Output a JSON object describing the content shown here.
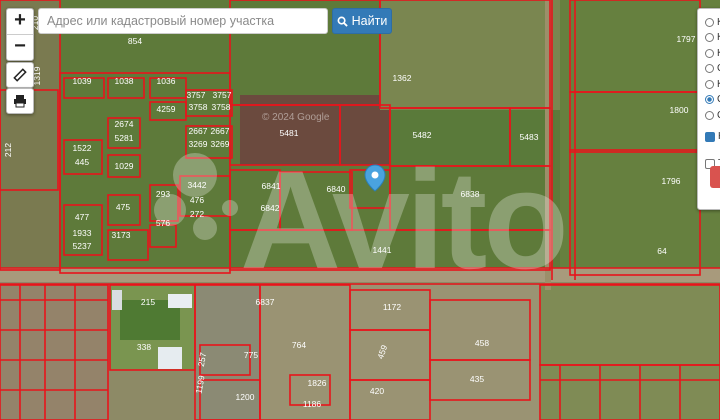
{
  "map": {
    "watermark": "© 2024 Google",
    "brand_watermark": "Avito",
    "parcels": [
      "854",
      "1039",
      "1038",
      "1036",
      "3757",
      "3757",
      "3758",
      "3758",
      "4259",
      "2674",
      "5281",
      "2667",
      "2667",
      "3269",
      "3269",
      "1522",
      "445",
      "1029",
      "6841",
      "6840",
      "6838",
      "5481",
      "5482",
      "5483",
      "3442",
      "476",
      "293",
      "272",
      "475",
      "576",
      "477",
      "1933",
      "3173",
      "5237",
      "6842",
      "1441",
      "1362",
      "1797",
      "1800",
      "1796",
      "64",
      "1319",
      "212",
      "210",
      "215",
      "338",
      "1172",
      "6837",
      "764",
      "459",
      "458",
      "435",
      "775",
      "1826",
      "420",
      "1200",
      "257",
      "1199",
      "1186",
      "10"
    ]
  },
  "controls": {
    "zoom_in": "+",
    "zoom_out": "−",
    "ruler_icon": "ruler-icon",
    "print_icon": "print-icon"
  },
  "search": {
    "placeholder": "Адрес или кадастровый номер участка",
    "button_label": "Найти",
    "button_icon": "search-icon"
  },
  "layers_panel": {
    "items": [
      {
        "label": "К",
        "checked": false
      },
      {
        "label": "К",
        "checked": false
      },
      {
        "label": "К",
        "checked": false
      },
      {
        "label": "С",
        "checked": false
      },
      {
        "label": "К",
        "checked": false
      },
      {
        "label": "С",
        "checked": true
      },
      {
        "label": "С",
        "checked": false
      }
    ],
    "checkboxes": [
      {
        "label": "К",
        "checked": true
      },
      {
        "label": "Т",
        "checked": false
      }
    ]
  },
  "marker": {
    "icon": "map-pin-icon"
  },
  "colors": {
    "parcel_border": "#e8141b",
    "button": "#337ab7",
    "accent": "#d9534f"
  }
}
